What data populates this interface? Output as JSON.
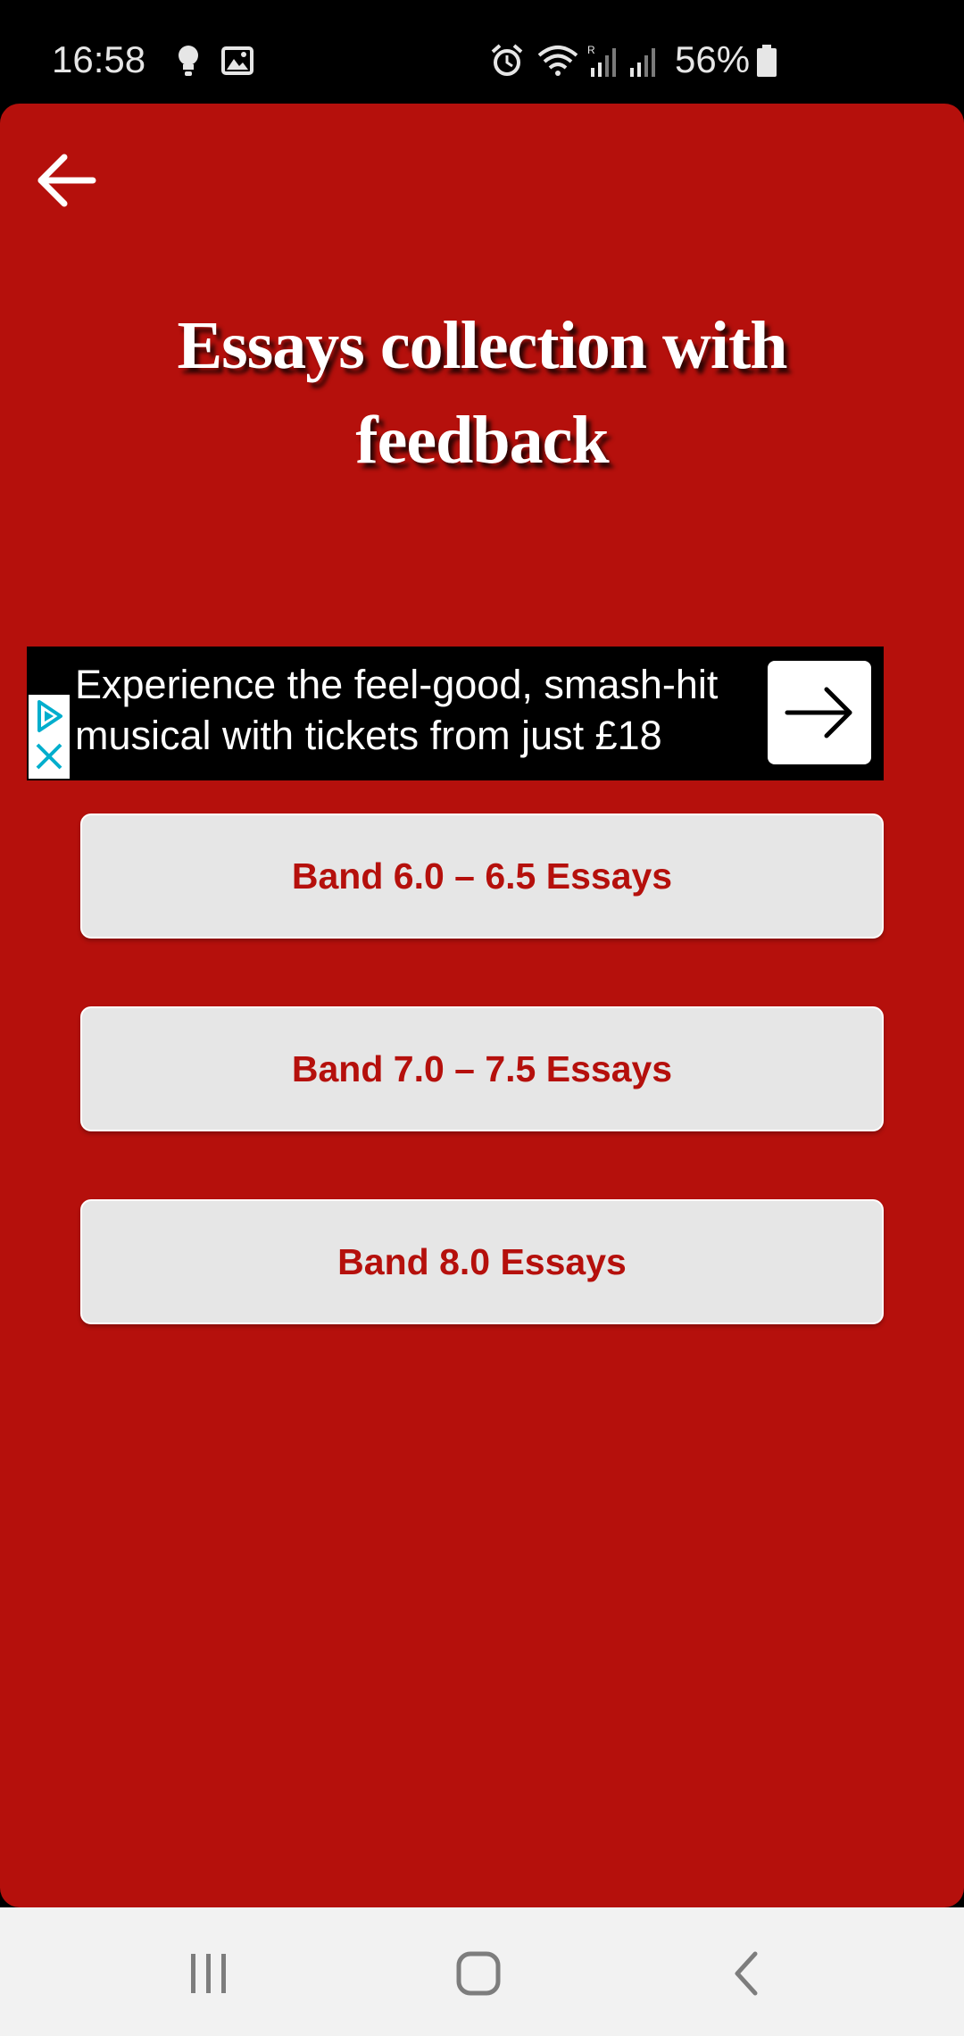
{
  "status_bar": {
    "time": "16:58",
    "battery_percent": "56%",
    "icons": [
      "bulb-icon",
      "image-icon",
      "alarm-icon",
      "wifi-icon",
      "signal-roaming-icon",
      "signal-icon",
      "battery-icon"
    ]
  },
  "header": {
    "back_icon": "arrow-left-icon",
    "title": "Essays collection with feedback"
  },
  "ad": {
    "text": "Experience the feel-good, smash-hit\nmusical with tickets from just £18",
    "badge_icons": [
      "adchoices-icon",
      "close-icon"
    ],
    "cta_icon": "arrow-right-icon"
  },
  "menu": {
    "items": [
      {
        "label": "Band 6.0 – 6.5 Essays"
      },
      {
        "label": "Band 7.0 – 7.5 Essays"
      },
      {
        "label": "Band 8.0 Essays"
      }
    ]
  },
  "nav_bar": {
    "recent_icon": "recent-apps-icon",
    "home_icon": "home-icon",
    "back_icon": "chevron-left-icon"
  },
  "colors": {
    "primary": "#b5100c",
    "button_bg": "#e6e6e6",
    "title_text": "#ffffff"
  }
}
